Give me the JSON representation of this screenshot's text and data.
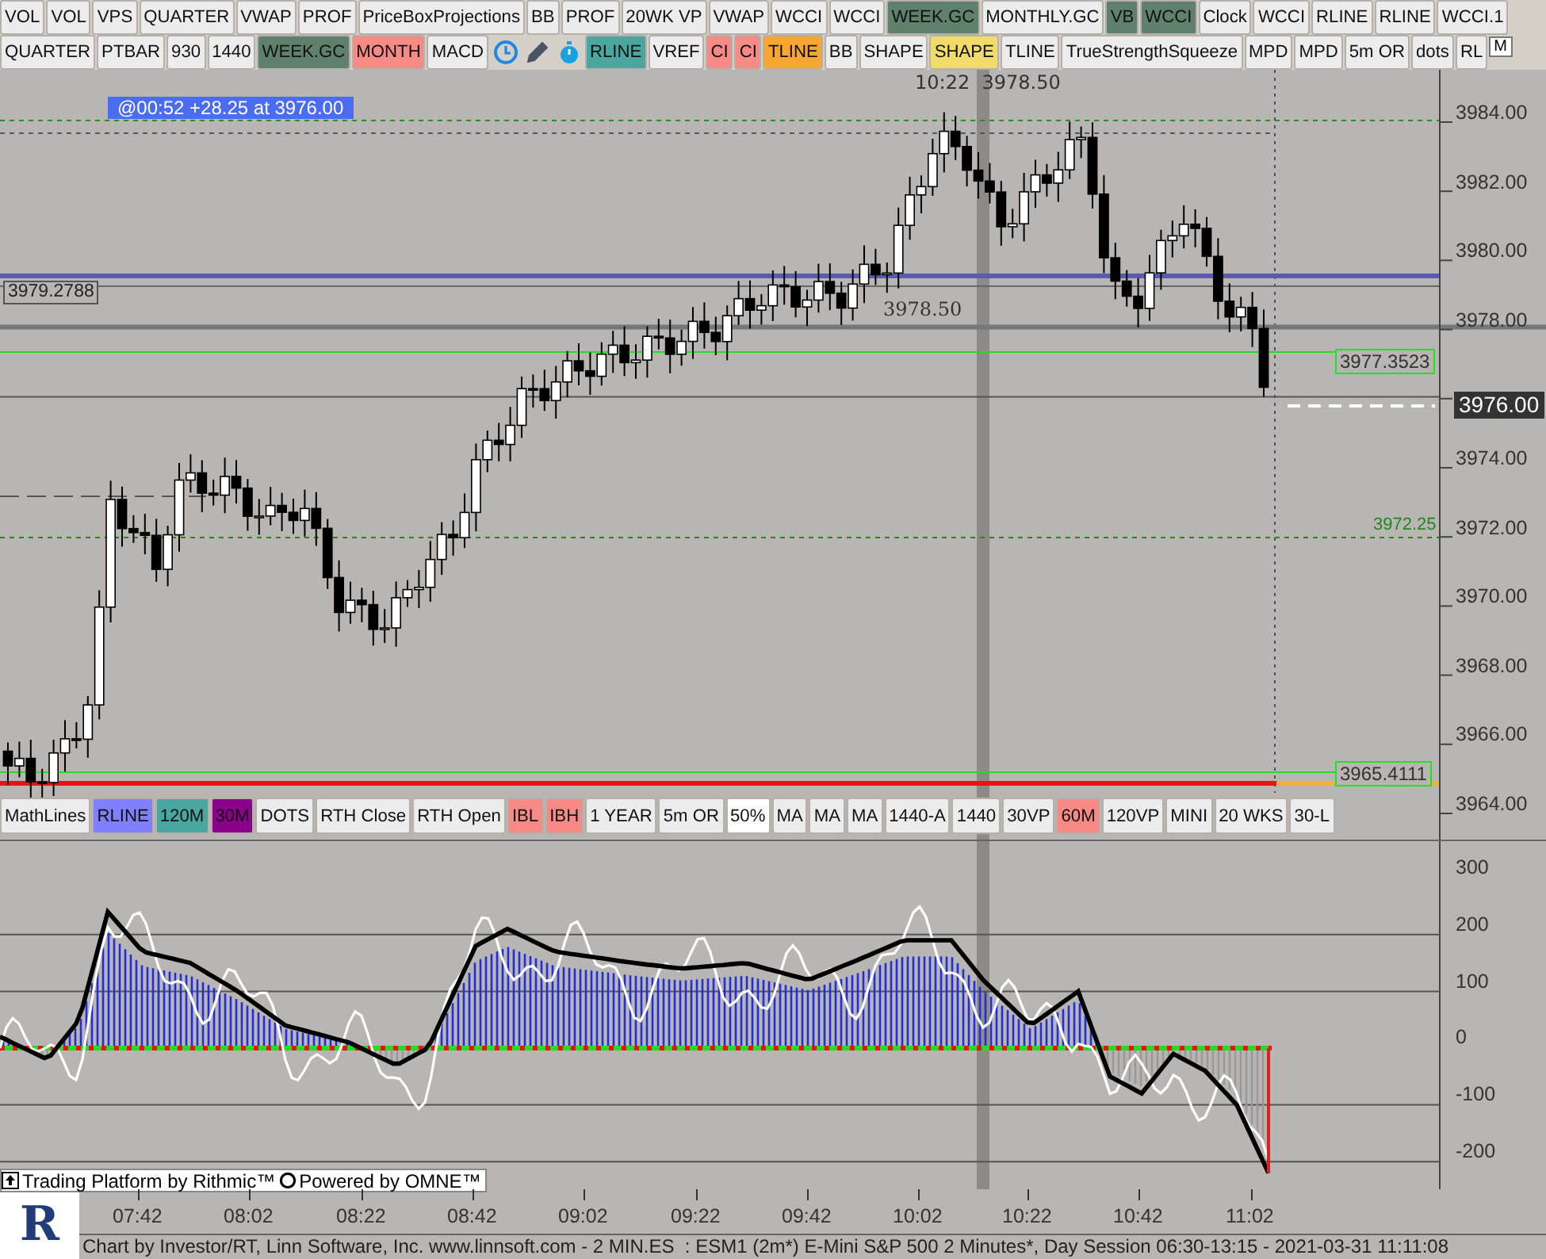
{
  "toolbar_1": [
    {
      "label": "VOL",
      "color": "#ececec"
    },
    {
      "label": "VOL",
      "color": "#ececec"
    },
    {
      "label": "VPS",
      "color": "#ececec"
    },
    {
      "label": "QUARTER",
      "color": "#ececec"
    },
    {
      "label": "VWAP",
      "color": "#ececec"
    },
    {
      "label": "PROF",
      "color": "#ececec"
    },
    {
      "label": "PriceBoxProjections",
      "color": "#ececec"
    },
    {
      "label": "BB",
      "color": "#ececec"
    },
    {
      "label": "PROF",
      "color": "#ececec"
    },
    {
      "label": "20WK VP",
      "color": "#ececec"
    },
    {
      "label": "VWAP",
      "color": "#ececec"
    },
    {
      "label": "WCCI",
      "color": "#ececec"
    },
    {
      "label": "WCCI",
      "color": "#ececec"
    },
    {
      "label": "WEEK.GC",
      "color": "#5f806b"
    },
    {
      "label": "MONTHLY.GC",
      "color": "#ececec"
    },
    {
      "label": "VB",
      "color": "#5f806b"
    },
    {
      "label": "WCCI",
      "color": "#5f806b"
    },
    {
      "label": "Clock",
      "color": "#ececec"
    },
    {
      "label": "WCCI",
      "color": "#ececec"
    },
    {
      "label": "RLINE",
      "color": "#ececec"
    },
    {
      "label": "RLINE",
      "color": "#ececec"
    },
    {
      "label": "WCCI.1",
      "color": "#ececec"
    }
  ],
  "toolbar_2": [
    {
      "kind": "button",
      "label": "QUARTER",
      "color": "#ececec"
    },
    {
      "kind": "button",
      "label": "PTBAR",
      "color": "#ececec"
    },
    {
      "kind": "button",
      "label": "930",
      "color": "#ececec"
    },
    {
      "kind": "button",
      "label": "1440",
      "color": "#ececec"
    },
    {
      "kind": "button",
      "label": "WEEK.GC",
      "color": "#5f806b"
    },
    {
      "kind": "button",
      "label": "MONTH",
      "color": "#f78a84"
    },
    {
      "kind": "button",
      "label": "MACD",
      "color": "#ececec"
    },
    {
      "kind": "clock"
    },
    {
      "kind": "pen"
    },
    {
      "kind": "timer"
    },
    {
      "kind": "button",
      "label": "RLINE",
      "color": "#4aa6a0"
    },
    {
      "kind": "button",
      "label": "VREF",
      "color": "#ececec"
    },
    {
      "kind": "button",
      "label": "CI",
      "color": "#f78a84"
    },
    {
      "kind": "button",
      "label": "CI",
      "color": "#f78a84"
    },
    {
      "kind": "button",
      "label": "TLINE",
      "color": "#f7a630"
    },
    {
      "kind": "button",
      "label": "BB",
      "color": "#ececec"
    },
    {
      "kind": "button",
      "label": "SHAPE",
      "color": "#ececec"
    },
    {
      "kind": "button",
      "label": "SHAPE",
      "color": "#f1dc6a"
    },
    {
      "kind": "button",
      "label": "TLINE",
      "color": "#ececec"
    },
    {
      "kind": "button",
      "label": "TrueStrengthSqueeze",
      "color": "#ececec"
    },
    {
      "kind": "button",
      "label": "MPD",
      "color": "#ececec"
    },
    {
      "kind": "button",
      "label": "MPD",
      "color": "#ececec"
    },
    {
      "kind": "button",
      "label": "5m OR",
      "color": "#ececec"
    },
    {
      "kind": "button",
      "label": "dots",
      "color": "#ececec"
    },
    {
      "kind": "button",
      "label": "RL",
      "color": "#ececec"
    }
  ],
  "corner_badge": "M",
  "price_chart": {
    "info_label": "@00:52  +28.25 at 3976.00",
    "crosshair_label": "10:22  3978.50",
    "level_labels": [
      {
        "text": "3979.2788",
        "kind": "plain"
      },
      {
        "text": "3978.50",
        "kind": "bare"
      },
      {
        "text": "3977.3523",
        "kind": "boxed"
      },
      {
        "text": "3972.25",
        "kind": "green"
      },
      {
        "text": "3965.4111",
        "kind": "boxed"
      }
    ],
    "current_price": "3976.00",
    "y_axis": [
      "3984.00",
      "3982.00",
      "3980.00",
      "3978.00",
      "3974.00",
      "3972.00",
      "3970.00",
      "3968.00",
      "3966.00",
      "3964.00"
    ]
  },
  "chart_buttons": [
    {
      "label": "MathLines",
      "color": "#ececec"
    },
    {
      "label": "RLINE",
      "color": "#8080ff"
    },
    {
      "label": "120M",
      "color": "#4aa6a0"
    },
    {
      "label": "30M",
      "color": "#8b008b"
    },
    {
      "label": "DOTS",
      "color": "#ececec"
    },
    {
      "label": "RTH Close",
      "color": "#ececec"
    },
    {
      "label": "RTH Open",
      "color": "#ececec"
    },
    {
      "label": "IBL",
      "color": "#f78a84"
    },
    {
      "label": "IBH",
      "color": "#f78a84"
    },
    {
      "label": "1 YEAR",
      "color": "#ececec"
    },
    {
      "label": "5m OR",
      "color": "#ececec"
    },
    {
      "label": "50%",
      "color": "#ffffff"
    },
    {
      "label": "MA",
      "color": "#ececec"
    },
    {
      "label": "MA",
      "color": "#ececec"
    },
    {
      "label": "MA",
      "color": "#ececec"
    },
    {
      "label": "1440-A",
      "color": "#ececec"
    },
    {
      "label": "1440",
      "color": "#ececec"
    },
    {
      "label": "30VP",
      "color": "#ececec"
    },
    {
      "label": "60M",
      "color": "#f78a84"
    },
    {
      "label": "120VP",
      "color": "#ececec"
    },
    {
      "label": "MINI",
      "color": "#ececec"
    },
    {
      "label": "20 WKS",
      "color": "#ececec"
    },
    {
      "label": "30-L",
      "color": "#ececec"
    }
  ],
  "indicator": {
    "y_axis": [
      "300",
      "200",
      "100",
      "0",
      "-100",
      "-200"
    ]
  },
  "branding": {
    "rithmic": "Trading Platform by Rithmic™",
    "omne": "Powered by OMNE™"
  },
  "logo": "R",
  "time_axis": [
    "07:42",
    "08:02",
    "08:22",
    "08:42",
    "09:02",
    "09:22",
    "09:42",
    "10:02",
    "10:22",
    "10:42",
    "11:02"
  ],
  "status_bar": "Chart by Investor/RT, Linn Software, Inc. www.linnsoft.com - 2 MIN.ES  : ESM1 (2m*) E-Mini S&P 500 2 Minutes*, Day Session 06:30-13:15 - 2021-03-31 11:11:08"
}
